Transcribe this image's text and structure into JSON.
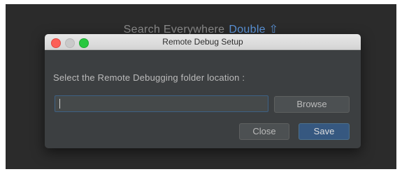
{
  "background_hint": {
    "text": "Search Everywhere",
    "shortcut": "Double ⇧"
  },
  "dialog": {
    "title": "Remote Debug Setup",
    "prompt": "Select the Remote Debugging folder location :",
    "path_input": {
      "value": "",
      "placeholder": ""
    },
    "browse_label": "Browse",
    "close_label": "Close",
    "save_label": "Save"
  },
  "colors": {
    "ide_background": "#2b2b2b",
    "dialog_background": "#3c3f41",
    "accent_blue": "#365880",
    "hint_shortcut_blue": "#5a93d8",
    "focus_border": "#3d6185"
  },
  "icons": {
    "traffic_lights": [
      "close-window-icon",
      "minimize-window-icon",
      "zoom-window-icon"
    ]
  }
}
